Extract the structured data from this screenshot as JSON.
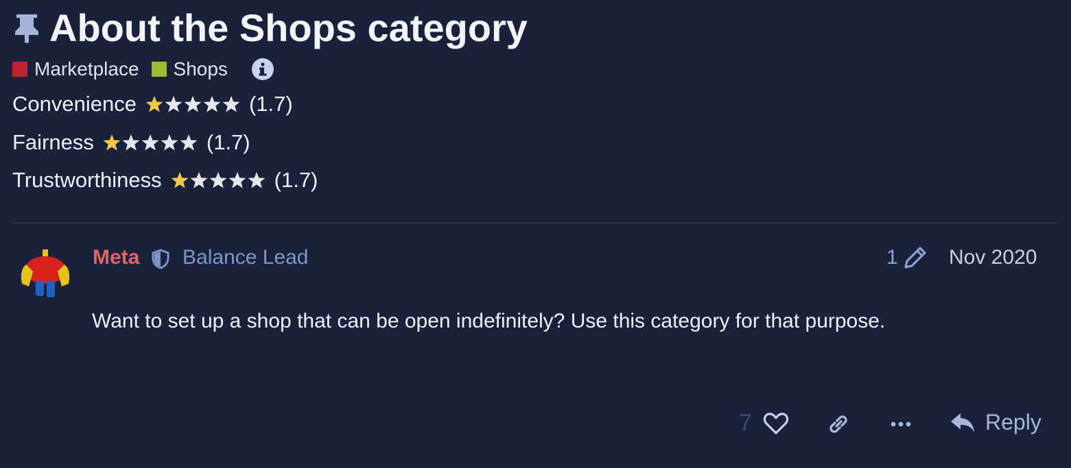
{
  "topic": {
    "title": "About the Shops category",
    "categories": [
      {
        "label": "Marketplace",
        "color": "#c0202f"
      },
      {
        "label": "Shops",
        "color": "#9ebd2e"
      }
    ]
  },
  "ratings": [
    {
      "label": "Convenience",
      "value": "(1.7)",
      "filled_stars": 1
    },
    {
      "label": "Fairness",
      "value": "(1.7)",
      "filled_stars": 1
    },
    {
      "label": "Trustworthiness",
      "value": "(1.7)",
      "filled_stars": 1
    }
  ],
  "post": {
    "username": "Meta",
    "user_title": "Balance Lead",
    "edit_count": "1",
    "date": "Nov 2020",
    "body": "Want to set up a shop that can be open indefinitely? Use this category for that purpose.",
    "like_count": "7",
    "reply_label": "Reply"
  },
  "colors": {
    "background": "#19223a",
    "star_filled": "#f3c84b",
    "star_empty": "#e6e8ee",
    "username": "#e06666",
    "user_title": "#8295c9"
  },
  "icons": [
    "pin-icon",
    "info-icon",
    "star-icon",
    "shield-icon",
    "pencil-icon",
    "heart-icon",
    "link-icon",
    "more-icon",
    "reply-icon"
  ]
}
